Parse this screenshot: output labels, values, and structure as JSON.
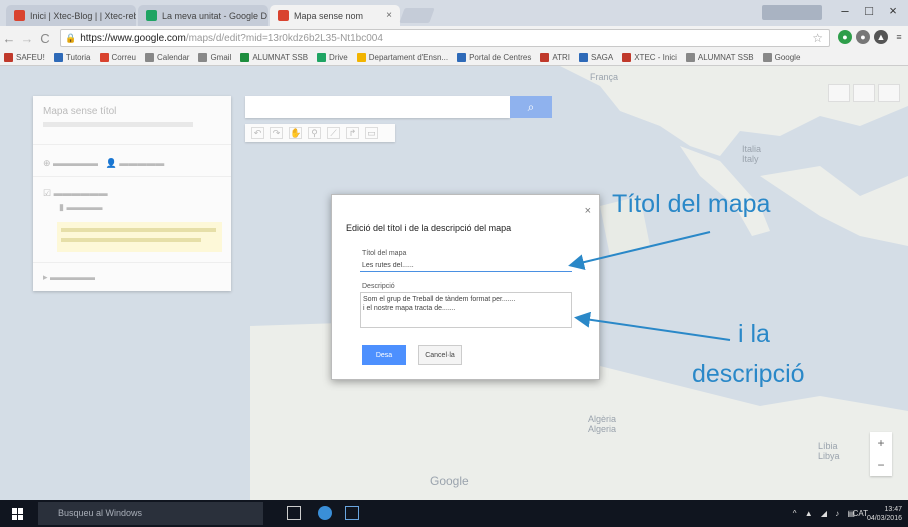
{
  "browser": {
    "tabs": [
      {
        "label": "Inici | Xtec-Blog | | Xtec-reb",
        "favicon_color": "#d9432f"
      },
      {
        "label": "La meva unitat - Google D",
        "favicon_color": "#1fa463"
      },
      {
        "label": "Mapa sense nom",
        "favicon_color": "#d9432f"
      }
    ],
    "url_host": "https://www.google.com",
    "url_path": "/maps/d/edit?mid=13r0kdz6b2L35-Nt1bc004"
  },
  "bookmarks": [
    {
      "label": "SAFEU!",
      "color": "#c0392b"
    },
    {
      "label": "Tutoria",
      "color": "#2e6ab8"
    },
    {
      "label": "Correu",
      "color": "#d9432f"
    },
    {
      "label": "Calendar",
      "color": "#888888"
    },
    {
      "label": "Gmail",
      "color": "#888888"
    },
    {
      "label": "ALUMNAT SSB",
      "color": "#1e8e3e"
    },
    {
      "label": "Drive",
      "color": "#1fa463"
    },
    {
      "label": "Departament d'Ensn...",
      "color": "#f2b400"
    },
    {
      "label": "Portal de Centres",
      "color": "#2e6ab8"
    },
    {
      "label": "ATRI",
      "color": "#c0392b"
    },
    {
      "label": "SAGA",
      "color": "#2e6ab8"
    },
    {
      "label": "XTEC - Inici",
      "color": "#c0392b"
    },
    {
      "label": "ALUMNAT SSB",
      "color": "#888888"
    },
    {
      "label": "Google",
      "color": "#888888"
    }
  ],
  "map": {
    "panel_title": "Mapa sense títol",
    "labels": [
      {
        "text": "Italia\nItaly"
      },
      {
        "text": "Algèria\nAlgeria"
      },
      {
        "text": "Líbia\nLibya"
      },
      {
        "text": "França"
      }
    ],
    "google_logo": "Google",
    "search_button_icon": "search-icon"
  },
  "dialog": {
    "title": "Edició del títol i de la descripció del mapa",
    "title_label": "Títol del mapa",
    "title_value": "Les rutes del......",
    "description_label": "Descripció",
    "description_value": "Som el grup de Treball de tàndem format per.......\ni el nostre mapa tracta de.......",
    "save_label": "Desa",
    "cancel_label": "Cancel·la",
    "close_icon": "close-icon"
  },
  "annotations": {
    "title_note": "Títol del mapa",
    "desc_note_line1": "i la",
    "desc_note_line2": "descripció",
    "arrow_color": "#2a88c8"
  },
  "taskbar": {
    "search_placeholder": "Busqueu al Windows",
    "language": "CAT",
    "time": "13:47",
    "date": "04/03/2016"
  }
}
